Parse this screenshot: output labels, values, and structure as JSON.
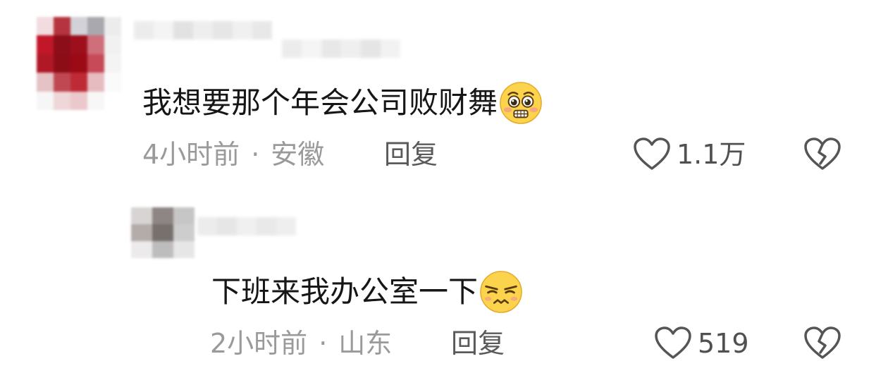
{
  "comments": [
    {
      "text": "我想要那个年会公司败财舞",
      "emoji": "pleading-face-emoji",
      "time": "4小时前",
      "separator": "·",
      "location": "安徽",
      "reply_label": "回复",
      "likes": "1.1万",
      "avatar_colors": [
        "#f2dce0",
        "#b5343f",
        "#d2d2d8",
        "#a8a8ae",
        "#ececec",
        "#c11728",
        "#8c0e18",
        "#9e0f1c",
        "#cf6f7a",
        "#f1f1f1",
        "#b01826",
        "#8d0d17",
        "#9b0a15",
        "#c64a57",
        "#f4f4f4",
        "#e5c2c5",
        "#c04853",
        "#be2b36",
        "#e7bcc0",
        "#fafafa",
        "#f6f6f6",
        "#efd6d8",
        "#ebc8cb",
        "#f7f7f7",
        "#ffffff"
      ],
      "username_colors": [
        "#ececec",
        "#f4f4f4",
        "#e2e2e2",
        "#eeeeee",
        "#e6e6e6",
        "#f0f0f0",
        "#e8e8e8"
      ],
      "username2_colors": [
        "#ececec",
        "#f5f5f5",
        "#e8e8e8",
        "#efefef",
        "#e5e5e5",
        "#f2f2f2"
      ]
    },
    {
      "text": "下班来我办公室一下",
      "emoji": "smirk-face-emoji",
      "time": "2小时前",
      "separator": "·",
      "location": "山东",
      "reply_label": "回复",
      "likes": "519",
      "avatar_colors": [
        "#d8d4d4",
        "#8e8684",
        "#c6c6c6",
        "#b4aca9",
        "#77706d",
        "#cdcdcd",
        "#eceaea",
        "#bdbdbd",
        "#e6e6e6"
      ],
      "username_colors": [
        "#ececec",
        "#e6e6e6",
        "#f0f0f0",
        "#e9e9e9",
        "#eeeeee"
      ]
    }
  ]
}
